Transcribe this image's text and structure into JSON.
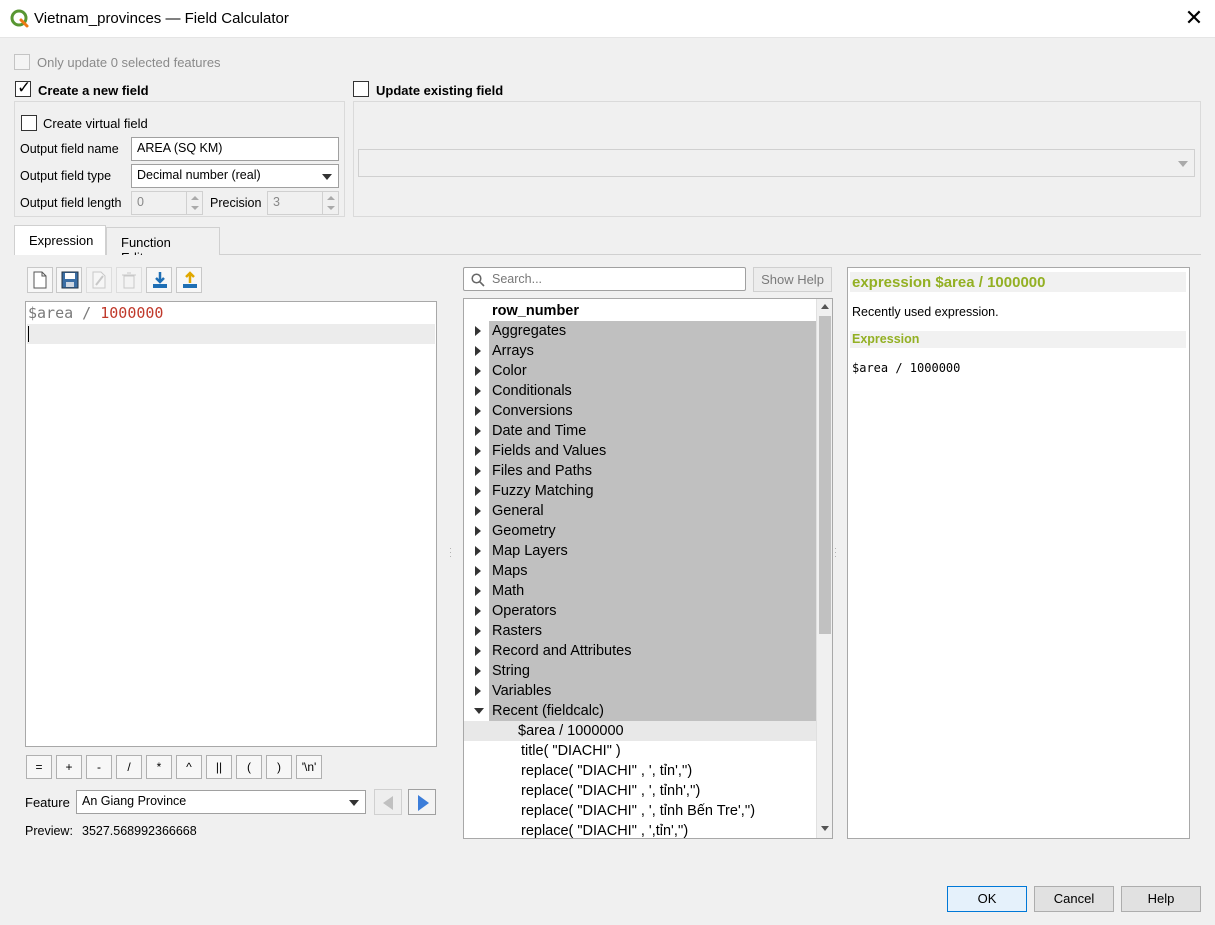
{
  "window": {
    "title": "Vietnam_provinces — Field Calculator"
  },
  "top": {
    "only_update": "Only update 0 selected features",
    "create_new_field": "Create a new field",
    "update_existing": "Update existing field",
    "create_virtual": "Create virtual field",
    "output_name_label": "Output field name",
    "output_name_value": "AREA (SQ KM)",
    "output_type_label": "Output field type",
    "output_type_value": "Decimal number (real)",
    "output_length_label": "Output field length",
    "output_length_value": "0",
    "precision_label": "Precision",
    "precision_value": "3"
  },
  "tabs": [
    "Expression",
    "Function Editor"
  ],
  "editor": {
    "token_field": "$area",
    "token_op": " / ",
    "token_num": "1000000"
  },
  "operators": [
    "=",
    "+",
    "-",
    "/",
    "*",
    "^",
    "||",
    "(",
    ")",
    "'\\n'"
  ],
  "feature": {
    "label": "Feature",
    "value": "An Giang Province"
  },
  "preview": {
    "label": "Preview:",
    "value": "3527.568992366668"
  },
  "search": {
    "placeholder": "Search...",
    "show_help": "Show Help"
  },
  "tree": {
    "top_item": "row_number",
    "groups": [
      "Aggregates",
      "Arrays",
      "Color",
      "Conditionals",
      "Conversions",
      "Date and Time",
      "Fields and Values",
      "Files and Paths",
      "Fuzzy Matching",
      "General",
      "Geometry",
      "Map Layers",
      "Maps",
      "Math",
      "Operators",
      "Rasters",
      "Record and Attributes",
      "String",
      "Variables"
    ],
    "recent_group": "Recent (fieldcalc)",
    "recent_items": [
      "$area / 1000000",
      "title(  \"DIACHI\" )",
      "replace( \"DIACHI\" , ', tỉn','')",
      "replace( \"DIACHI\" , ', tỉnh','')",
      "replace( \"DIACHI\" , ', tỉnh Bến Tre','')",
      "replace( \"DIACHI\" , ',tỉn','')"
    ]
  },
  "help": {
    "title": "expression $area / 1000000",
    "desc": "Recently used expression.",
    "section": "Expression",
    "code": "$area / 1000000"
  },
  "buttons": {
    "ok": "OK",
    "cancel": "Cancel",
    "help": "Help"
  },
  "colors": {
    "accent_green": "#93b023",
    "field_color": "#7a7a7a",
    "number_color": "#c0392b"
  }
}
